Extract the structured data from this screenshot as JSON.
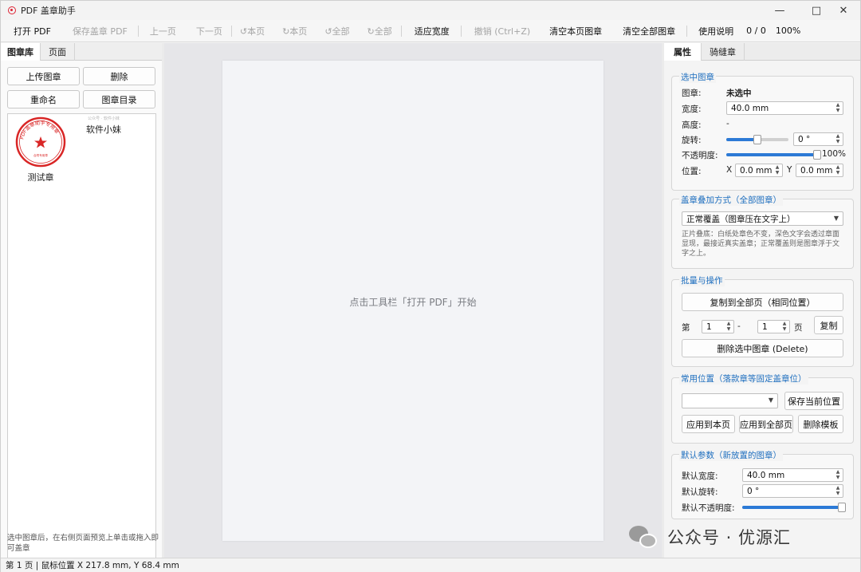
{
  "window": {
    "title": "PDF 盖章助手",
    "minimize_icon": "minimize-icon",
    "maximize_icon": "maximize-icon",
    "close_icon": "close-icon"
  },
  "toolbar": {
    "open_pdf": "打开 PDF",
    "save_pdf": "保存盖章 PDF",
    "prev_page": "上一页",
    "next_page": "下一页",
    "rotate_page_ccw": "↺本页",
    "rotate_page_cw": "↻本页",
    "rotate_all_ccw": "↺全部",
    "rotate_all_cw": "↻全部",
    "fit_width": "适应宽度",
    "undo": "撤销 (Ctrl+Z)",
    "clear_page": "清空本页图章",
    "clear_all": "清空全部图章",
    "help": "使用说明",
    "page_counter": "0 / 0",
    "zoom": "100%"
  },
  "left_panel": {
    "tabs": [
      "图章库",
      "页面"
    ],
    "upload": "上传图章",
    "delete": "删除",
    "rename": "重命名",
    "folder": "图章目录",
    "stamps": [
      {
        "name": "测试章",
        "ring_text": "PDF盖章助手专用章",
        "inner_text": "合同专用章"
      },
      {
        "name": "软件小妹",
        "caption": "公众号 · 软件小妹"
      }
    ],
    "hint": "选中图章后，在右侧页面预览上单击或拖入即可盖章"
  },
  "canvas": {
    "placeholder": "点击工具栏「打开 PDF」开始"
  },
  "right_panel": {
    "tabs": [
      "属性",
      "骑缝章"
    ],
    "selected": {
      "title": "选中图章",
      "stamp_label": "图章:",
      "stamp_value": "未选中",
      "width_label": "宽度:",
      "width_value": "40.0 mm",
      "height_label": "高度:",
      "height_value": "-",
      "rotate_label": "旋转:",
      "rotate_value": "0 °",
      "rotate_fraction": 0.5,
      "opacity_label": "不透明度:",
      "opacity_value": "100%",
      "opacity_fraction": 1.0,
      "pos_label": "位置:",
      "x_label": "X",
      "x_value": "0.0 mm",
      "y_label": "Y",
      "y_value": "0.0 mm"
    },
    "blend": {
      "title": "盖章叠加方式（全部图章）",
      "mode": "正常覆盖（图章压在文字上）",
      "desc": "正片叠底：白纸处章色不变，深色文字会透过章面显现，最接近真实盖章；正常覆盖则是图章浮于文字之上。"
    },
    "batch": {
      "title": "批量与操作",
      "copy_all": "复制到全部页（相同位置）",
      "page_prefix": "第",
      "from_page": "1",
      "dash": "-",
      "to_page": "1",
      "page_suffix": "页",
      "copy": "复制",
      "delete_selected": "删除选中图章 (Delete)"
    },
    "common": {
      "title": "常用位置（落款章等固定盖章位）",
      "combo_value": "",
      "save_pos": "保存当前位置",
      "apply_page": "应用到本页",
      "apply_all": "应用到全部页",
      "delete_tpl": "删除模板"
    },
    "defaults": {
      "title": "默认参数（新放置的图章）",
      "width_label": "默认宽度:",
      "width_value": "40.0 mm",
      "rotate_label": "默认旋转:",
      "rotate_value": "0 °",
      "opacity_label": "默认不透明度:",
      "opacity_fraction": 1.0
    }
  },
  "status": {
    "text": "第 1 页 | 鼠标位置 X 217.8 mm, Y 68.4 mm"
  },
  "watermark": {
    "text": "公众号 · 优源汇"
  },
  "colors": {
    "accent": "#2c7ad6",
    "stamp_red": "#d92626",
    "group_title": "#1f6fbf"
  }
}
